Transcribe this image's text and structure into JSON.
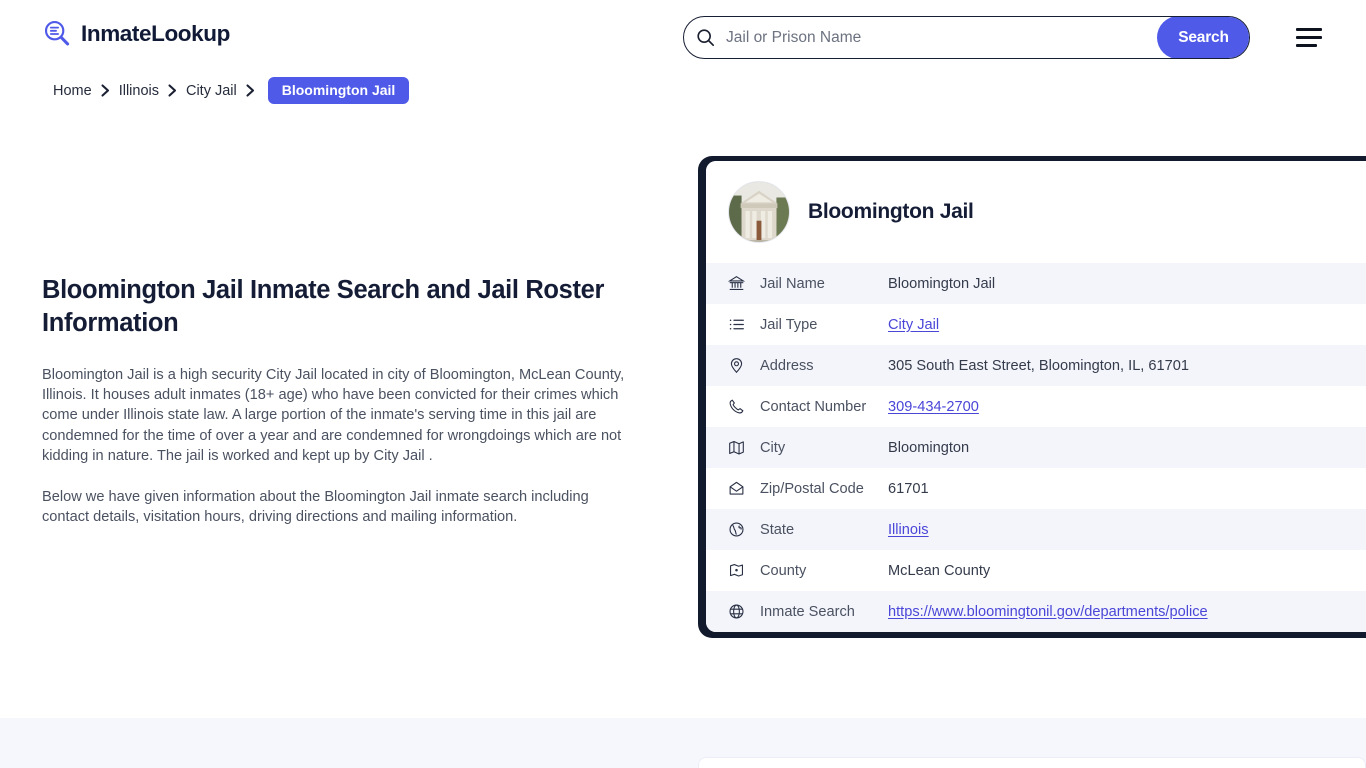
{
  "header": {
    "brand_name": "InmateLookup",
    "brand_icon": "magnifier-list-logo-icon",
    "search": {
      "placeholder": "Jail or Prison Name",
      "value": "",
      "icon": "search-icon",
      "button_label": "Search"
    },
    "menu_icon": "hamburger-menu-icon"
  },
  "breadcrumb": {
    "items": [
      {
        "label": "Home",
        "current": false
      },
      {
        "label": "Illinois",
        "current": false
      },
      {
        "label": "City Jail",
        "current": false
      },
      {
        "label": "Bloomington Jail",
        "current": true
      }
    ],
    "separator_icon": "chevron-right-icon"
  },
  "main": {
    "title": "Bloomington Jail Inmate Search and Jail Roster Information",
    "paragraphs": [
      "Bloomington Jail is a high security City Jail located in city of Bloomington, McLean County, Illinois. It houses adult inmates (18+ age) who have been convicted for their crimes which come under Illinois state law. A large portion of the inmate's serving time in this jail are condemned for the time of over a year and are condemned for wrongdoings which are not kidding in nature. The jail is worked and kept up by City Jail .",
      "Below we have given information about the Bloomington Jail inmate search including contact details, visitation hours, driving directions and mailing information."
    ]
  },
  "info_card": {
    "title": "Bloomington Jail",
    "avatar_icon": "courthouse-building-photo",
    "rows": [
      {
        "icon": "bank-icon",
        "label": "Jail Name",
        "value": "Bloomington Jail",
        "link": false
      },
      {
        "icon": "list-icon",
        "label": "Jail Type",
        "value": "City Jail",
        "link": true
      },
      {
        "icon": "map-pin-icon",
        "label": "Address",
        "value": "305 South East Street, Bloomington, IL, 61701",
        "link": false
      },
      {
        "icon": "phone-icon",
        "label": "Contact Number",
        "value": "309-434-2700",
        "link": true
      },
      {
        "icon": "map-icon",
        "label": "City",
        "value": "Bloomington",
        "link": false
      },
      {
        "icon": "envelope-icon",
        "label": "Zip/Postal Code",
        "value": "61701",
        "link": false
      },
      {
        "icon": "globe-grid-icon",
        "label": "State",
        "value": "Illinois",
        "link": true
      },
      {
        "icon": "map-marker-icon",
        "label": "County",
        "value": "McLean County",
        "link": false
      },
      {
        "icon": "globe-icon",
        "label": "Inmate Search",
        "value": "https://www.bloomingtonil.gov/departments/police",
        "link": true
      }
    ]
  },
  "colors": {
    "accent_blue": "#4f5ae8",
    "link_blue": "#4a46d8",
    "dark_navy": "#121a2e",
    "row_alt": "#f4f5fb",
    "bottom_band": "#f6f6fd"
  }
}
